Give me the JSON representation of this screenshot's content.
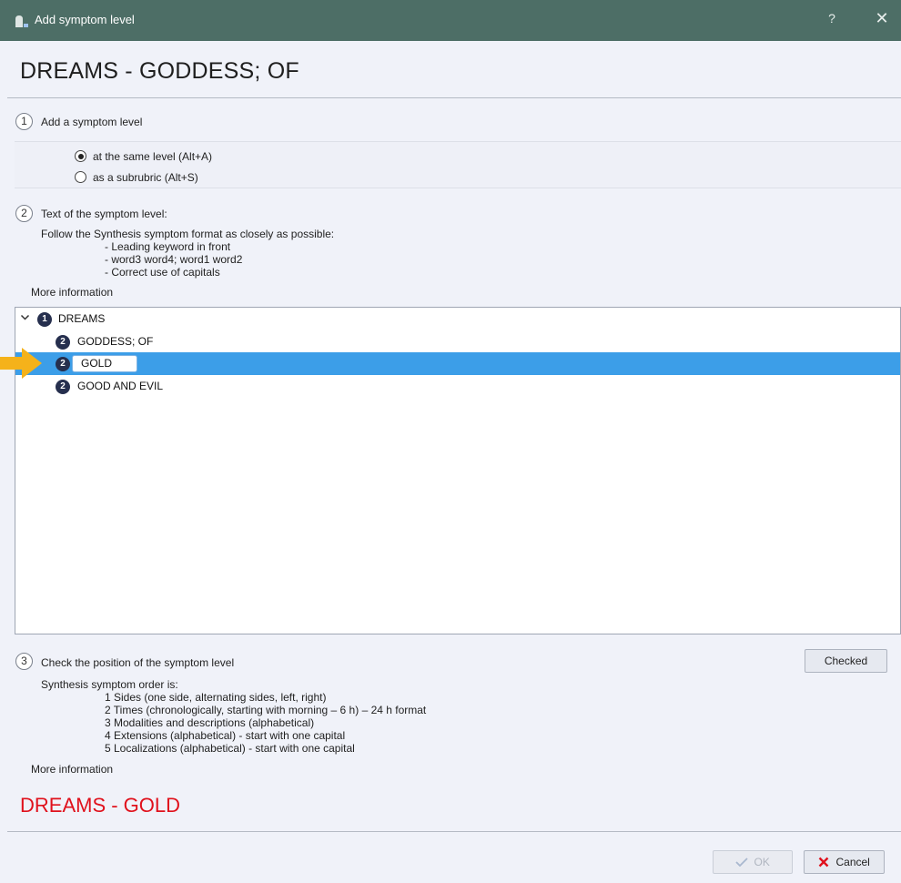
{
  "window": {
    "title": "Add symptom level",
    "help_label": "?",
    "close_label": "✕"
  },
  "heading": "DREAMS - GODDESS; OF",
  "step1": {
    "number": "1",
    "label": "Add a symptom level",
    "options": [
      {
        "label": "at the same level  (Alt+A)",
        "checked": true
      },
      {
        "label": "as a subrubric (Alt+S)",
        "checked": false
      }
    ]
  },
  "step2": {
    "number": "2",
    "label": "Text of the symptom level:",
    "intro": "Follow the Synthesis symptom format as closely as possible:",
    "rules": [
      "- Leading keyword in front",
      "- word3 word4; word1 word2",
      "- Correct use of capitals"
    ],
    "more_info": "More information"
  },
  "tree": {
    "items": [
      {
        "level": "1",
        "text": "DREAMS",
        "expanded": true
      },
      {
        "level": "2",
        "text": "GODDESS; OF"
      },
      {
        "level": "2",
        "text": "GOLD",
        "selected": true
      },
      {
        "level": "2",
        "text": "GOOD AND EVIL"
      }
    ]
  },
  "step3": {
    "number": "3",
    "label": "Check the position of the symptom level",
    "checked_button": "Checked",
    "intro": "Synthesis symptom order is:",
    "rules": [
      "1 Sides (one side, alternating sides, left, right)",
      "2 Times (chronologically, starting with morning – 6 h) – 24 h format",
      "3 Modalities and descriptions (alphabetical)",
      "4 Extensions (alphabetical) - start with one capital",
      "5 Localizations (alphabetical) - start with one capital"
    ],
    "more_info": "More information"
  },
  "result": "DREAMS - GOLD",
  "footer": {
    "ok_label": "OK",
    "cancel_label": "Cancel"
  },
  "colors": {
    "titlebar": "#4d6e66",
    "selection": "#3c9ee8",
    "result_text": "#e0111c",
    "arrow": "#f5b21a"
  }
}
